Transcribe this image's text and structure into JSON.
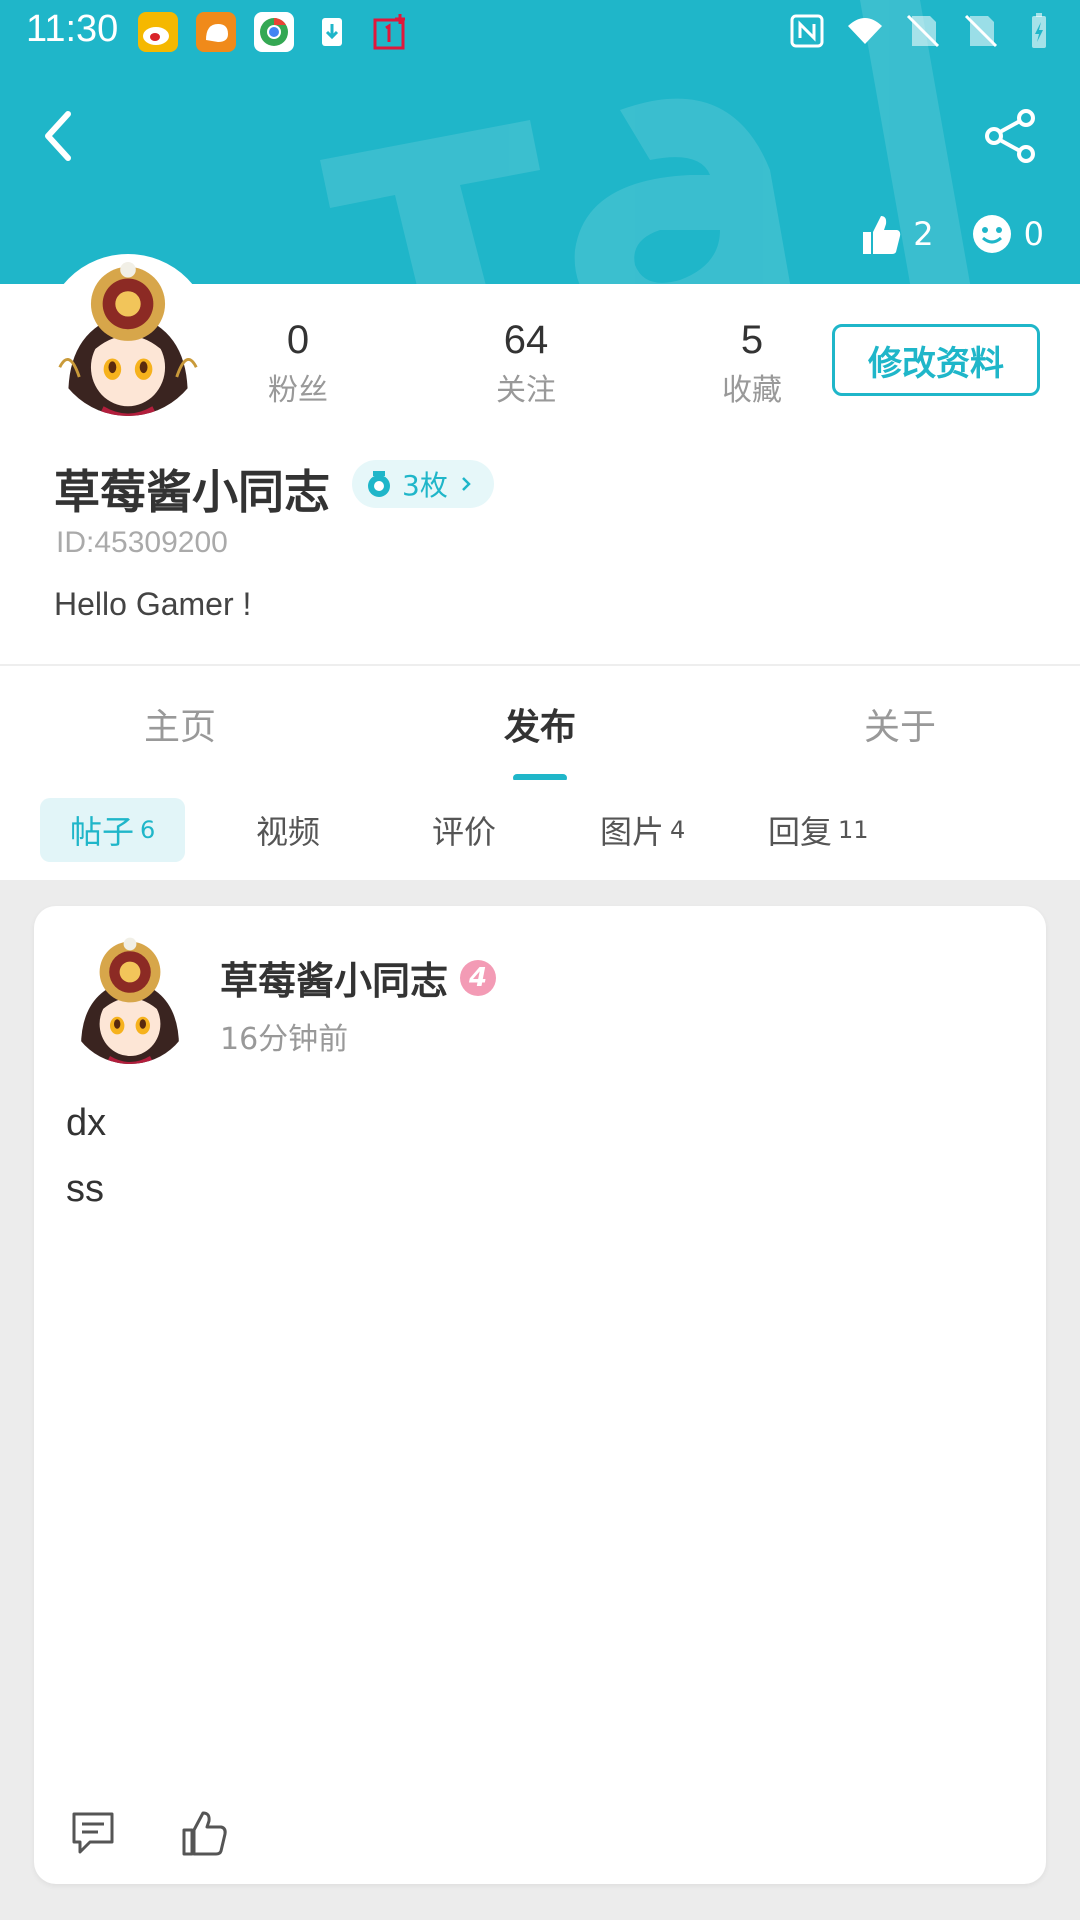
{
  "status_bar": {
    "time": "11:30",
    "apps": [
      "weibo-icon",
      "uc-browser-icon",
      "chrome-icon",
      "download-icon",
      "oneplus-icon"
    ],
    "indicators": [
      "nfc-icon",
      "wifi-icon",
      "no-sim-icon",
      "no-sim-icon",
      "battery-icon"
    ]
  },
  "header": {
    "likes_count": "2",
    "emoji_count": "0",
    "accent_color": "#1fb6c9"
  },
  "profile": {
    "stats": [
      {
        "value": "0",
        "label": "粉丝"
      },
      {
        "value": "64",
        "label": "关注"
      },
      {
        "value": "5",
        "label": "收藏"
      }
    ],
    "edit_button": "修改资料",
    "nickname": "草莓酱小同志",
    "medal": "3枚",
    "uid": "ID:45309200",
    "bio": "Hello Gamer !"
  },
  "tabs": [
    {
      "label": "主页"
    },
    {
      "label": "发布"
    },
    {
      "label": "关于"
    }
  ],
  "subtabs": [
    {
      "label": "帖子",
      "count": "6"
    },
    {
      "label": "视频",
      "count": ""
    },
    {
      "label": "评价",
      "count": ""
    },
    {
      "label": "图片",
      "count": "4"
    },
    {
      "label": "回复",
      "count": "11"
    }
  ],
  "post": {
    "author": "草莓酱小同志",
    "level": "4",
    "time": "16分钟前",
    "lines": [
      "dx",
      "ss"
    ]
  }
}
